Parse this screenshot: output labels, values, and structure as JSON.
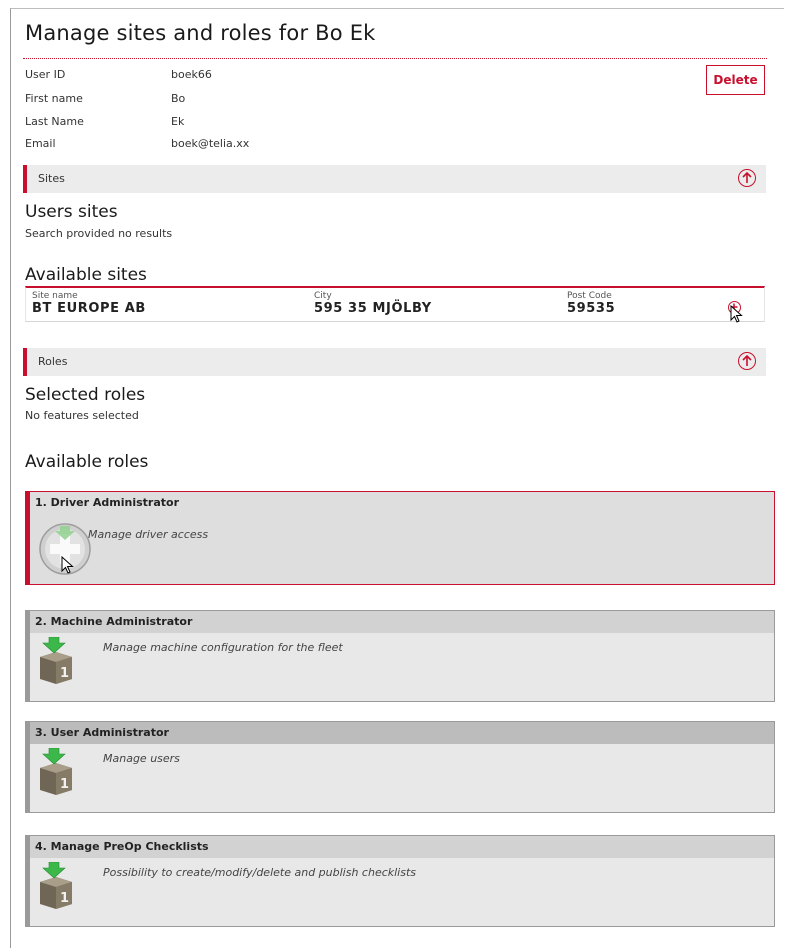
{
  "page": {
    "title": "Manage sites and roles for Bo Ek"
  },
  "user": {
    "fields": [
      {
        "label": "User ID",
        "value": "boek66"
      },
      {
        "label": "First name",
        "value": "Bo"
      },
      {
        "label": "Last Name",
        "value": "Ek"
      },
      {
        "label": "Email",
        "value": "boek@telia.xx"
      }
    ],
    "delete_label": "Delete"
  },
  "sites": {
    "section_label": "Sites",
    "users_sites_heading": "Users sites",
    "users_sites_note": "Search provided no results",
    "available_heading": "Available sites",
    "columns": [
      "Site name",
      "City",
      "Post Code"
    ],
    "rows": [
      {
        "name": "BT EUROPE AB",
        "city": "595 35 MJÖLBY",
        "post_code": "59535"
      }
    ]
  },
  "roles": {
    "section_label": "Roles",
    "selected_heading": "Selected roles",
    "selected_note": "No features selected",
    "available_heading": "Available roles",
    "items": [
      {
        "title": "1. Driver Administrator",
        "description": "Manage driver access",
        "badge": ""
      },
      {
        "title": "2. Machine Administrator",
        "description": "Manage machine configuration for the fleet",
        "badge": "1"
      },
      {
        "title": "3. User Administrator",
        "description": "Manage users",
        "badge": "1"
      },
      {
        "title": "4. Manage PreOp Checklists",
        "description": "Possibility to create/modify/delete and publish checklists",
        "badge": "1"
      }
    ]
  },
  "colors": {
    "accent": "#c8102e",
    "section_bg": "#ececec",
    "card_bg": "#e8e8e8"
  },
  "icons": [
    "arrow-up-circle-icon",
    "add-circle-icon",
    "role-box-icon",
    "add-role-icon",
    "mouse-pointer-icon"
  ]
}
